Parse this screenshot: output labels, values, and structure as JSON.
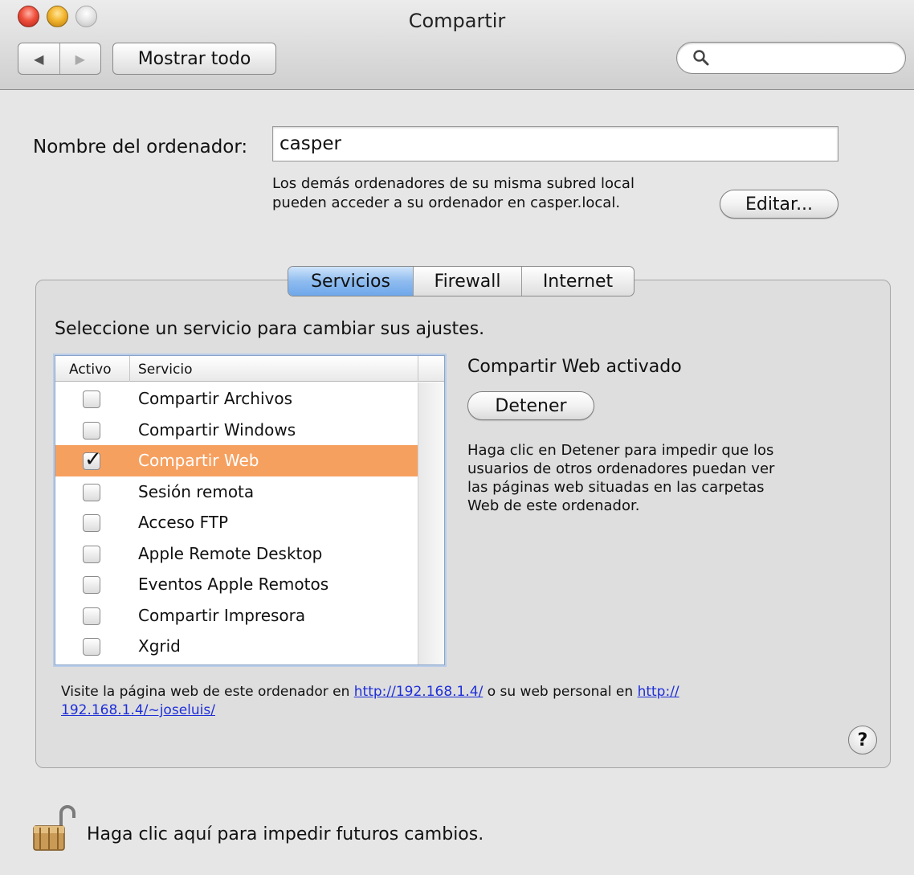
{
  "window": {
    "title": "Compartir"
  },
  "toolbar": {
    "back_glyph": "◀",
    "forward_glyph": "▶",
    "show_all_label": "Mostrar todo",
    "search_placeholder": ""
  },
  "computer_name": {
    "label": "Nombre del ordenador:",
    "value": "casper",
    "note_line1": "Los demás ordenadores de su misma subred local",
    "note_line2": "pueden acceder a su ordenador en casper.local.",
    "edit_label": "Editar..."
  },
  "tabs": [
    {
      "label": "Servicios",
      "selected": true
    },
    {
      "label": "Firewall",
      "selected": false
    },
    {
      "label": "Internet",
      "selected": false
    }
  ],
  "instruction": "Seleccione un servicio para cambiar sus ajustes.",
  "services_table": {
    "columns": [
      "Activo",
      "Servicio"
    ],
    "rows": [
      {
        "name": "Compartir Archivos",
        "active": false,
        "selected": false
      },
      {
        "name": "Compartir Windows",
        "active": false,
        "selected": false
      },
      {
        "name": "Compartir Web",
        "active": true,
        "selected": true
      },
      {
        "name": "Sesión remota",
        "active": false,
        "selected": false
      },
      {
        "name": "Acceso FTP",
        "active": false,
        "selected": false
      },
      {
        "name": "Apple Remote Desktop",
        "active": false,
        "selected": false
      },
      {
        "name": "Eventos Apple Remotos",
        "active": false,
        "selected": false
      },
      {
        "name": "Compartir Impresora",
        "active": false,
        "selected": false
      },
      {
        "name": "Xgrid",
        "active": false,
        "selected": false
      }
    ]
  },
  "detail": {
    "status": "Compartir Web activado",
    "stop_label": "Detener",
    "description_lines": [
      "Haga clic en Detener para impedir que los",
      "usuarios de otros ordenadores puedan ver",
      "las páginas web situadas en las carpetas",
      "Web de este ordenador."
    ]
  },
  "visit": {
    "text1": "Visite la página web de este ordenador en ",
    "link1": "http://192.168.1.4/",
    "text2": " o su web personal en ",
    "link2a": "http://",
    "link2b": "192.168.1.4/~joseluis/"
  },
  "help_label": "?",
  "lock": {
    "text": "Haga clic aquí para impedir futuros cambios."
  },
  "colors": {
    "selection": "#f6a060",
    "tab_selected": "#8fbcef",
    "link": "#1f2fd8"
  }
}
